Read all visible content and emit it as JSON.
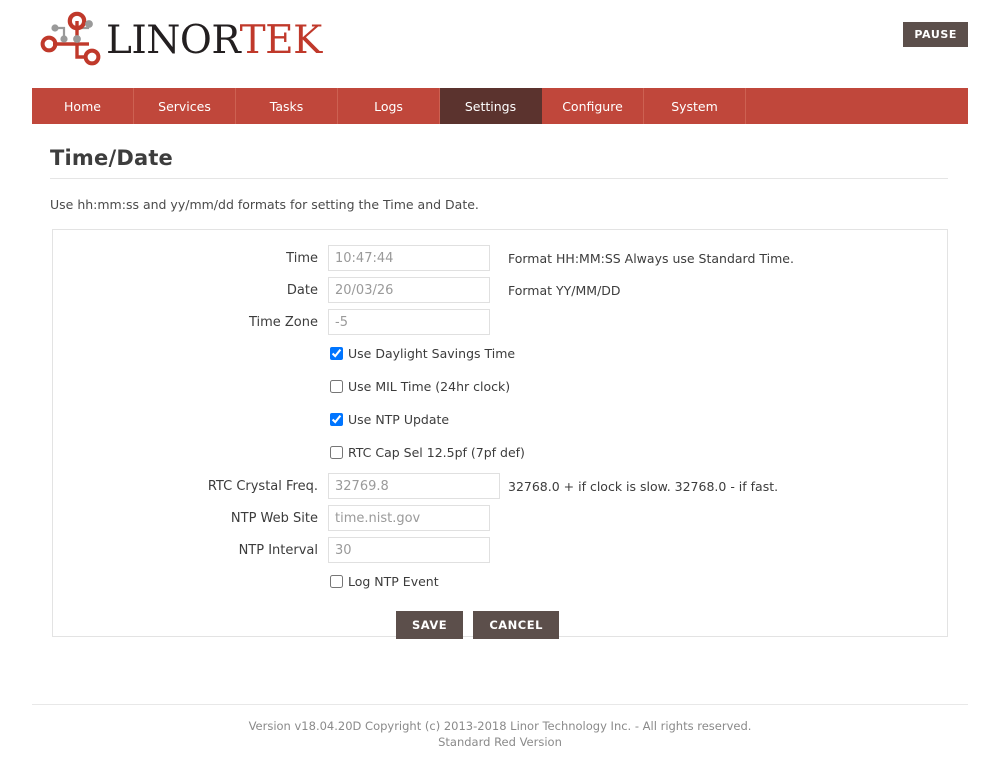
{
  "header": {
    "logo_text_dark": "LINOR",
    "logo_text_red": "TEK",
    "logo_icon": "circuit-nodes-icon",
    "pause_label": "PAUSE"
  },
  "nav": {
    "items": [
      {
        "label": "Home",
        "active": false
      },
      {
        "label": "Services",
        "active": false
      },
      {
        "label": "Tasks",
        "active": false
      },
      {
        "label": "Logs",
        "active": false
      },
      {
        "label": "Settings",
        "active": true
      },
      {
        "label": "Configure",
        "active": false
      },
      {
        "label": "System",
        "active": false
      }
    ]
  },
  "page": {
    "title": "Time/Date",
    "description": "Use hh:mm:ss and yy/mm/dd formats for setting the Time and Date."
  },
  "form": {
    "fields": [
      {
        "label": "Time",
        "value": "10:47:44",
        "hint": "Format HH:MM:SS Always use Standard Time."
      },
      {
        "label": "Date",
        "value": "20/03/26",
        "hint": "Format YY/MM/DD"
      },
      {
        "label": "Time Zone",
        "value": "-5",
        "hint": ""
      }
    ],
    "checkboxes_upper": [
      {
        "label": "Use Daylight Savings Time",
        "checked": true
      },
      {
        "label": "Use MIL Time (24hr clock)",
        "checked": false
      },
      {
        "label": "Use NTP Update",
        "checked": true
      },
      {
        "label": "RTC Cap Sel 12.5pf (7pf def)",
        "checked": false
      }
    ],
    "fields_lower": [
      {
        "label": "RTC Crystal Freq.",
        "value": "32769.8",
        "hint": "32768.0 + if clock is slow. 32768.0 - if fast."
      },
      {
        "label": "NTP Web Site",
        "value": "time.nist.gov",
        "hint": ""
      },
      {
        "label": "NTP Interval",
        "value": "30",
        "hint": ""
      }
    ],
    "checkboxes_lower": [
      {
        "label": "Log NTP Event",
        "checked": false
      }
    ],
    "save_label": "SAVE",
    "cancel_label": "CANCEL"
  },
  "footer": {
    "line1": "Version v18.04.20D Copyright (c) 2013-2018 Linor Technology Inc. - All rights reserved.",
    "line2": "Standard Red Version"
  },
  "colors": {
    "brand_red": "#c0473b",
    "nav_active": "#5b332e",
    "button_dark": "#5c4f4b",
    "logo_red": "#c0392b",
    "logo_dark": "#231f20"
  }
}
